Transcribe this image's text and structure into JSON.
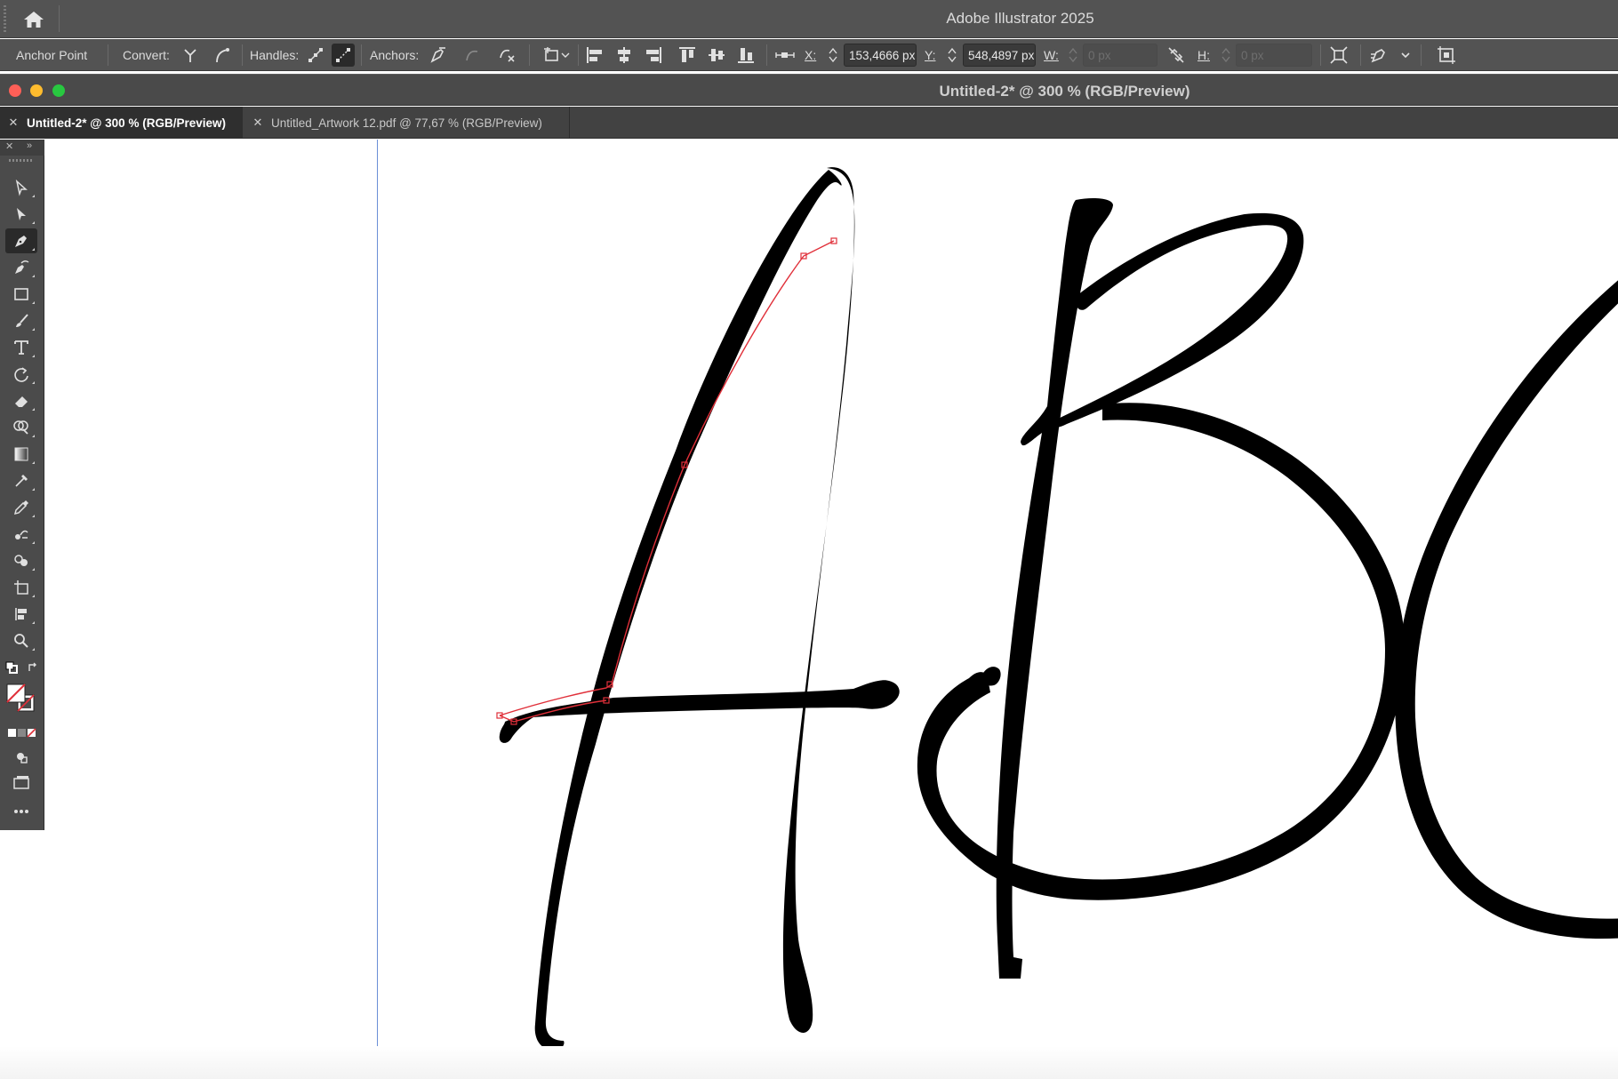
{
  "app": {
    "title": "Adobe Illustrator 2025"
  },
  "control_bar": {
    "context_label": "Anchor Point",
    "convert_label": "Convert:",
    "handles_label": "Handles:",
    "anchors_label": "Anchors:",
    "x_label": "X:",
    "x_value": "153,4666 px",
    "y_label": "Y:",
    "y_value": "548,4897 px",
    "w_label": "W:",
    "w_value": "0 px",
    "h_label": "H:",
    "h_value": "0 px"
  },
  "document": {
    "window_title": "Untitled-2* @ 300 % (RGB/Preview)"
  },
  "tabs": [
    {
      "label": "Untitled-2* @ 300 % (RGB/Preview)",
      "active": true
    },
    {
      "label": "Untitled_Artwork 12.pdf @ 77,67 % (RGB/Preview)",
      "active": false
    }
  ],
  "colors": {
    "ui_dark": "#535353",
    "panel": "#4b4b4b",
    "tab_active": "#2f2f2f",
    "selection_path": "#e0303a",
    "guide": "#6b8fd6",
    "traffic_close": "#fe5f57",
    "traffic_min": "#febc2e",
    "traffic_max": "#28c840"
  },
  "tools": [
    "selection-tool-icon",
    "direct-selection-tool-icon",
    "pen-tool-icon",
    "curvature-tool-icon",
    "rectangle-tool-icon",
    "paintbrush-tool-icon",
    "type-tool-icon",
    "rotate-tool-icon",
    "eraser-tool-icon",
    "shape-builder-tool-icon",
    "gradient-tool-icon",
    "mesh-tool-icon",
    "eyedropper-tool-icon",
    "blend-tool-icon",
    "symbol-sprayer-tool-icon",
    "artboard-tool-icon",
    "slice-tool-icon",
    "zoom-tool-icon"
  ]
}
